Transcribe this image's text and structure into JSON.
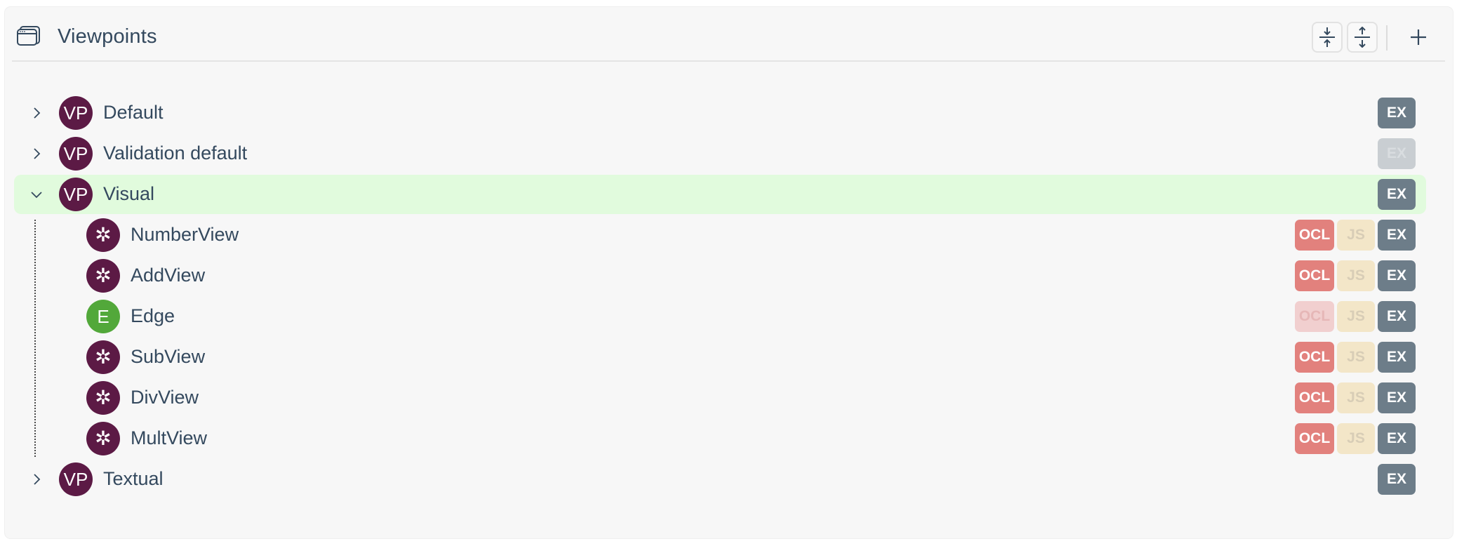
{
  "header": {
    "title": "Viewpoints",
    "title_icon": "window-icon",
    "buttons": [
      {
        "name": "collapse-all-button",
        "icon": "collapse-icon"
      },
      {
        "name": "expand-all-button",
        "icon": "expand-icon"
      },
      {
        "name": "add-button",
        "icon": "plus-icon"
      }
    ]
  },
  "tree": {
    "viewpoints": [
      {
        "label": "Default",
        "avatar": "VP",
        "expanded": false,
        "ex_enabled": true
      },
      {
        "label": "Validation default",
        "avatar": "VP",
        "expanded": false,
        "ex_enabled": false
      },
      {
        "label": "Visual",
        "avatar": "VP",
        "expanded": true,
        "selected": true,
        "ex_enabled": true,
        "children": [
          {
            "label": "NumberView",
            "avatar": "✲",
            "type": "view",
            "ocl_enabled": true
          },
          {
            "label": "AddView",
            "avatar": "✲",
            "type": "view",
            "ocl_enabled": true
          },
          {
            "label": "Edge",
            "avatar": "E",
            "type": "edge",
            "ocl_enabled": false
          },
          {
            "label": "SubView",
            "avatar": "✲",
            "type": "view",
            "ocl_enabled": true
          },
          {
            "label": "DivView",
            "avatar": "✲",
            "type": "view",
            "ocl_enabled": true
          },
          {
            "label": "MultView",
            "avatar": "✲",
            "type": "view",
            "ocl_enabled": true
          }
        ]
      },
      {
        "label": "Textual",
        "avatar": "VP",
        "expanded": false,
        "ex_enabled": true
      }
    ]
  },
  "badges": {
    "ocl": "OCL",
    "js": "JS",
    "ex": "EX"
  },
  "colors": {
    "viewpoint_avatar": "#5c1a45",
    "edge_avatar": "#52a83a",
    "selected_row": "#e1fbdd",
    "ex_badge": "#6d7d89",
    "ocl_badge": "#e2817d",
    "js_badge": "#f3e6c8"
  }
}
